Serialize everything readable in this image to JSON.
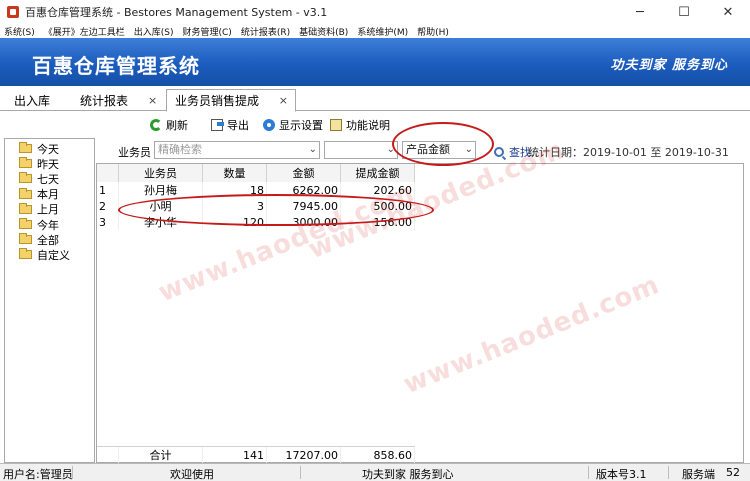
{
  "window": {
    "title": "百惠仓库管理系统 - Bestores Management System - v3.1",
    "minimize": "─",
    "maximize": "☐",
    "close": "✕"
  },
  "menu": [
    "系统(S)",
    "《展开》左边工具栏",
    "出入库(S)",
    "财务管理(C)",
    "统计报表(R)",
    "基础资料(B)",
    "系统维护(M)",
    "帮助(H)"
  ],
  "banner": {
    "title": "百惠仓库管理系统",
    "slogan": "功夫到家 服务到心"
  },
  "tabs": {
    "tab1": "出入库",
    "tab2": "统计报表",
    "tab3": "业务员销售提成",
    "close": "×"
  },
  "toolbar": {
    "refresh": "刷新",
    "export": "导出",
    "display_settings": "显示设置",
    "help": "功能说明"
  },
  "date_tree": [
    "今天",
    "昨天",
    "七天",
    "本月",
    "上月",
    "今年",
    "全部",
    "自定义"
  ],
  "filter": {
    "salesperson_label": "业务员",
    "search_placeholder": "精确检索",
    "combo_empty": "",
    "metric_value": "产品金额",
    "search_link": "查找..",
    "stat_date": "统计日期：2019-10-01 至 2019-10-31"
  },
  "grid": {
    "columns": [
      "业务员",
      "数量",
      "金额",
      "提成金额"
    ],
    "rows": [
      {
        "idx": "1",
        "name": "孙月梅",
        "qty": "18",
        "amount": "6262.00",
        "commission": "202.60"
      },
      {
        "idx": "2",
        "name": "小明",
        "qty": "3",
        "amount": "7945.00",
        "commission": "500.00"
      },
      {
        "idx": "3",
        "name": "李小华",
        "qty": "120",
        "amount": "3000.00",
        "commission": "156.00"
      }
    ],
    "footer": {
      "label": "合计",
      "qty": "141",
      "amount": "17207.00",
      "commission": "858.60"
    }
  },
  "watermark": "www.haoded.com",
  "status": {
    "user": "用户名:管理员",
    "welcome": "欢迎使用",
    "slogan": "功夫到家 服务到心",
    "version": "版本号3.1",
    "service_label": "服务端",
    "service_value": "52"
  },
  "colors": {
    "banner": "#1b5cbd",
    "highlight": "#c61a1a",
    "watermark": "#d62d2d"
  }
}
